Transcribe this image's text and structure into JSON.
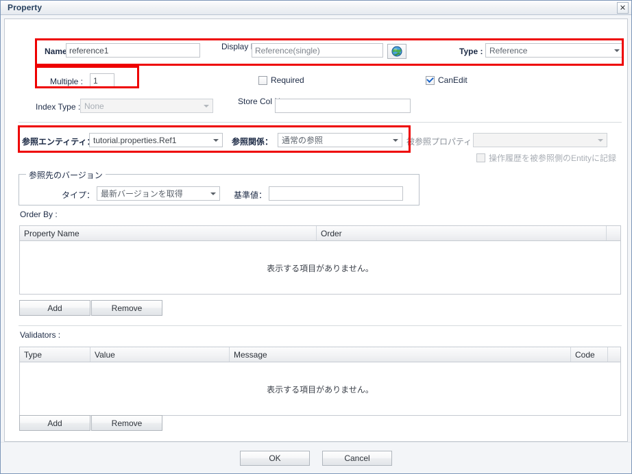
{
  "window": {
    "title": "Property",
    "close_icon": "close-icon"
  },
  "form": {
    "name_label": "Name :",
    "name_value": "reference1",
    "display_name_label": "Display Name :",
    "display_name_value": "Reference(single)",
    "globe_icon": "globe-icon",
    "type_label": "Type :",
    "type_value": "Reference",
    "multiple_label": "Multiple :",
    "multiple_value": "1",
    "required_label": "Required",
    "required_checked": false,
    "canedit_label": "CanEdit",
    "canedit_checked": true,
    "index_type_label": "Index Type :",
    "index_type_value": "None",
    "store_col_label": "Store Col Name :",
    "store_col_value": "",
    "ref_entity_label": "参照エンティティ：",
    "ref_entity_value": "tutorial.properties.Ref1",
    "ref_relation_label": "参照関係：",
    "ref_relation_value": "通常の参照",
    "referenced_prop_label": "被参照プロパティ：",
    "referenced_prop_value": "",
    "history_checkbox_label": "操作履歴を被参照側のEntityに記録",
    "history_checked": false
  },
  "version_group": {
    "title": "参照先のバージョン",
    "type_label": "タイプ：",
    "type_value": "最新バージョンを取得",
    "base_label": "基準値：",
    "base_value": ""
  },
  "order_by": {
    "label": "Order By :",
    "columns": [
      "Property Name",
      "Order",
      ""
    ],
    "empty_text": "表示する項目がありません。",
    "add_label": "Add",
    "remove_label": "Remove"
  },
  "validators": {
    "label": "Validators :",
    "columns": [
      "Type",
      "Value",
      "Message",
      "Code",
      ""
    ],
    "empty_text": "表示する項目がありません。",
    "add_label": "Add",
    "remove_label": "Remove"
  },
  "footer": {
    "ok_label": "OK",
    "cancel_label": "Cancel"
  },
  "colors": {
    "highlight": "#ee0000",
    "accent": "#27405e"
  }
}
